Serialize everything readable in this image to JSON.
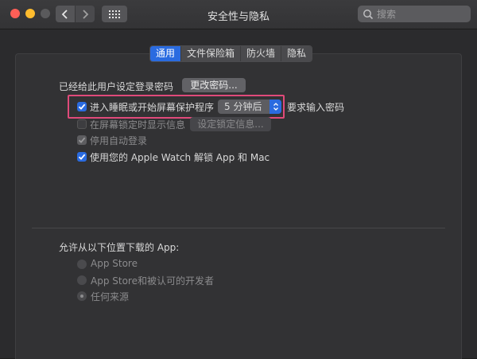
{
  "window": {
    "title": "安全性与隐私",
    "search_placeholder": "搜索"
  },
  "tabs": [
    {
      "label": "通用",
      "active": true
    },
    {
      "label": "文件保险箱",
      "active": false
    },
    {
      "label": "防火墙",
      "active": false
    },
    {
      "label": "隐私",
      "active": false
    }
  ],
  "general": {
    "password_set_text": "已经给此用户设定登录密码",
    "change_password_button": "更改密码...",
    "require_password": {
      "prefix": "进入睡眠或开始屏幕保护程序",
      "delay_value": "5 分钟后",
      "suffix": "要求输入密码",
      "checked": true
    },
    "show_message": {
      "label": "在屏幕锁定时显示信息",
      "button": "设定锁定信息...",
      "checked": false,
      "enabled": false
    },
    "disable_auto_login": {
      "label": "停用自动登录",
      "checked": true,
      "enabled": false
    },
    "apple_watch_unlock": {
      "label": "使用您的 Apple Watch 解锁 App 和 Mac",
      "checked": true
    }
  },
  "downloads": {
    "heading": "允许从以下位置下载的 App:",
    "options": [
      {
        "label": "App Store",
        "selected": false
      },
      {
        "label": "App Store和被认可的开发者",
        "selected": false
      },
      {
        "label": "任何来源",
        "selected": true
      }
    ]
  },
  "colors": {
    "accent": "#2a6be0",
    "highlight_border": "#e04a7a",
    "close": "#ff5f57",
    "minimize": "#febc2e"
  }
}
